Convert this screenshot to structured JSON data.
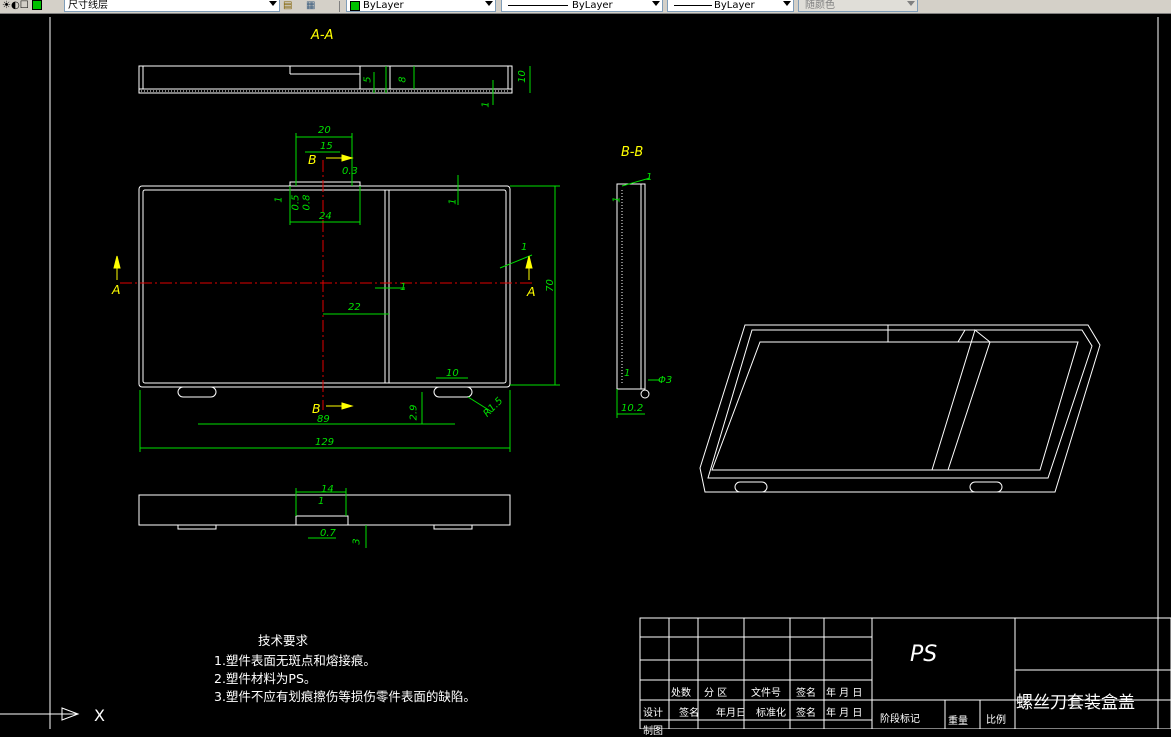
{
  "toolbar": {
    "layer_label": "尺寸线层",
    "color_value": "ByLayer",
    "linetype_value": "ByLayer",
    "lineweight_value": "ByLayer",
    "plotstyle_value": "随颜色"
  },
  "views": {
    "section_aa": "A-A",
    "section_bb": "B-B",
    "cut_a_left": "A",
    "cut_a_right": "A",
    "cut_b_top": "B",
    "cut_b_bottom": "B"
  },
  "dims": {
    "aa": [
      "5",
      "8",
      "1",
      "10"
    ],
    "plan": [
      "20",
      "15",
      "0.3",
      "1",
      "0.5",
      "0.8",
      "24",
      "1",
      "1",
      "1",
      "22",
      "70",
      "10",
      "2.9",
      "R1.5",
      "89",
      "129"
    ],
    "side": [
      "1",
      "1",
      "1",
      "Φ3",
      "10.2"
    ],
    "bottom": [
      "14",
      "1",
      "0.7",
      "3"
    ]
  },
  "tech": {
    "title": "技术要求",
    "items": [
      "1.塑件表面无斑点和熔接痕。",
      "2.塑件材料为PS。",
      "3.塑件不应有划痕擦伤等损伤零件表面的缺陷。"
    ]
  },
  "title_block": {
    "material": "PS",
    "part_name": "螺丝刀套装盒盖",
    "row1": [
      "处数",
      "分 区",
      "文件号",
      "签名",
      "年 月 日"
    ],
    "row2": [
      "设计",
      "签名",
      "年月日",
      "标准化",
      "签名",
      "年 月 日"
    ],
    "row3": [
      "制图"
    ],
    "stage": "阶段标记",
    "weight": "重量",
    "scale": "比例"
  },
  "ucs": {
    "x_label": "X"
  }
}
